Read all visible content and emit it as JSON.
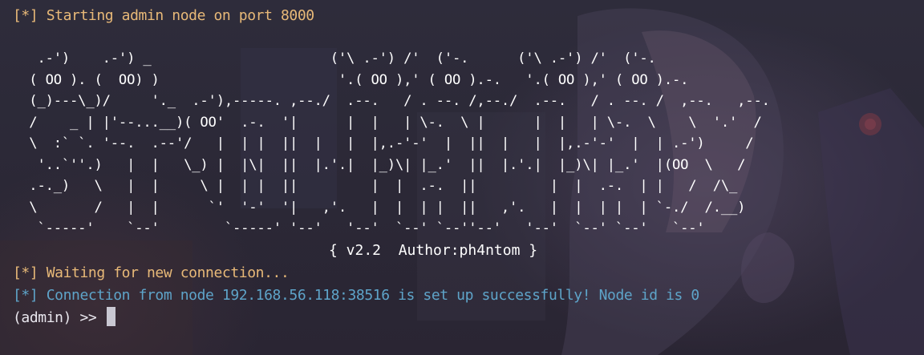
{
  "terminal": {
    "start_msg": "[*] Starting admin node on port 8000",
    "banner": [
      "   .-')    .-') _                      ('\\ .-') /'  ('-.      ('\\ .-') /'  ('-.",
      "  ( OO ). (  OO) )                      '.( OO ),' ( OO ).-.   '.( OO ),' ( OO ).-.",
      "  (_)---\\_)/     '._  .-'),-----. ,--./  .--.   / . --. /,--./  .--.   / . --. /  ,--.   ,--.",
      "  /    _ | |'--...__)( OO'  .-.  '|      |  |   | \\-.  \\ |      |  |   | \\-.  \\    \\  '.'  /",
      "  \\  :` `. '--.  .--'/   |  | |  ||  |   |  |,.-'-'  |  ||  |   |  |,.-'-'  |  | .-')     /",
      "   '..`''.)   |  |   \\_) |  |\\|  ||  |.'.|  |_)\\| |_.'  ||  |.'.|  |_)\\| |_.'  |(OO  \\   /",
      "  .-._)   \\   |  |     \\ |  | |  ||         |  |  .-.  ||         |  |  .-.  | |   /  /\\_",
      "  \\       /   |  |      `'  '-'  '|   ,'.   |  |  | |  ||   ,'.   |  |  | |  | `-./  /.__)",
      "   `-----'    `--'        `-----' '--'   '--'  `--' `--''--'   '--'  `--' `--'   `--'"
    ],
    "version_line": "{ v2.2  Author:ph4ntom }",
    "waiting_msg": "[*] Waiting for new connection...",
    "connection_msg": "[*] Connection from node 192.168.56.118:38516 is set up successfully! Node id is 0",
    "prompt": "(admin) >> "
  },
  "colors": {
    "background": "#2a2838",
    "status_orange": "#e8b978",
    "info_blue": "#5ea4c9",
    "text_white": "#e9e7ee"
  }
}
